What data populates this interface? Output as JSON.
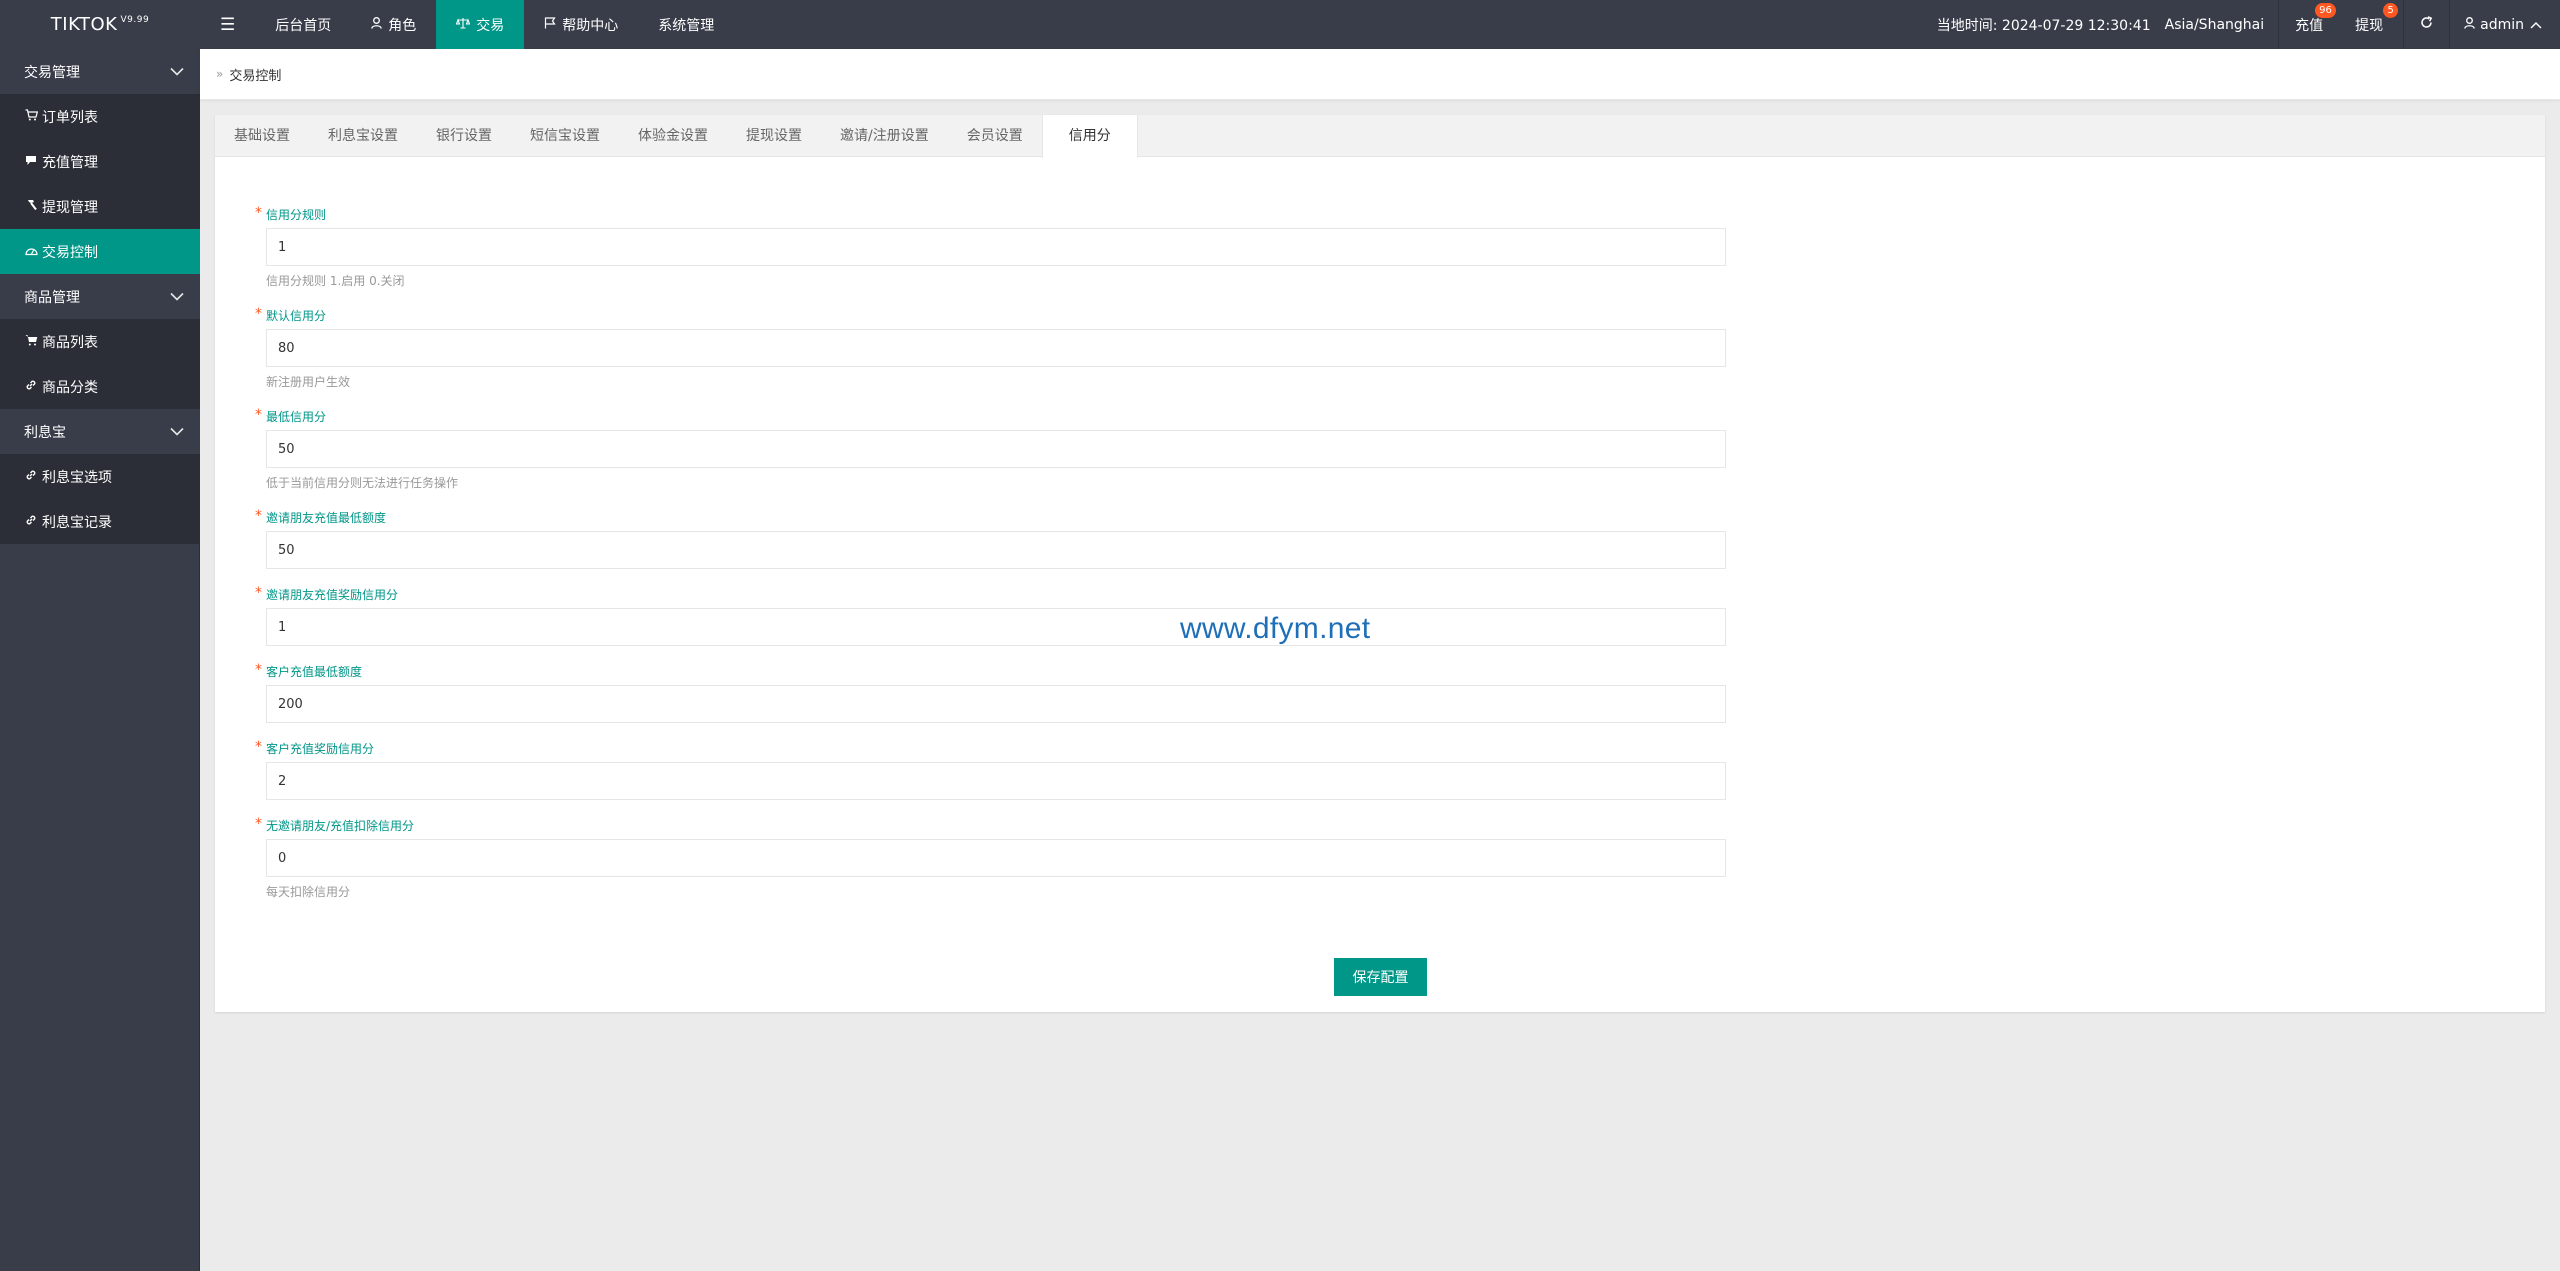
{
  "brand": {
    "name": "TIKTOK",
    "version": "V9.99"
  },
  "topnav": {
    "menu_icon": "menu-icon",
    "items": [
      {
        "label": "后台首页",
        "icon": ""
      },
      {
        "label": "角色",
        "icon": "user-icon"
      },
      {
        "label": "交易",
        "icon": "scale-icon",
        "active": true
      },
      {
        "label": "帮助中心",
        "icon": "flag-icon"
      },
      {
        "label": "系统管理",
        "icon": ""
      }
    ]
  },
  "topright": {
    "time_label": "当地时间: 2024-07-29 12:30:41",
    "timezone": "Asia/Shanghai",
    "recharge": {
      "label": "充值",
      "badge": "96"
    },
    "withdraw": {
      "label": "提现",
      "badge": "5"
    },
    "refresh_icon": "refresh-icon",
    "user": {
      "label": "admin",
      "icon": "user-icon",
      "chevron": "chevron-up-icon"
    }
  },
  "sidebar": {
    "groups": [
      {
        "label": "交易管理",
        "items": [
          {
            "label": "订单列表",
            "icon": "cart-icon"
          },
          {
            "label": "充值管理",
            "icon": "comment-icon"
          },
          {
            "label": "提现管理",
            "icon": "hammer-icon"
          },
          {
            "label": "交易控制",
            "icon": "dashboard-icon",
            "active": true
          }
        ]
      },
      {
        "label": "商品管理",
        "items": [
          {
            "label": "商品列表",
            "icon": "cart-icon"
          },
          {
            "label": "商品分类",
            "icon": "link-icon"
          }
        ]
      },
      {
        "label": "利息宝",
        "items": [
          {
            "label": "利息宝选项",
            "icon": "link-icon"
          },
          {
            "label": "利息宝记录",
            "icon": "link-icon"
          }
        ]
      }
    ]
  },
  "breadcrumb": {
    "current": "交易控制"
  },
  "tabs": [
    {
      "label": "基础设置"
    },
    {
      "label": "利息宝设置"
    },
    {
      "label": "银行设置"
    },
    {
      "label": "短信宝设置"
    },
    {
      "label": "体验金设置"
    },
    {
      "label": "提现设置"
    },
    {
      "label": "邀请/注册设置"
    },
    {
      "label": "会员设置"
    },
    {
      "label": "信用分",
      "active": true
    }
  ],
  "form": {
    "fields": [
      {
        "label": "信用分规则",
        "value": "1",
        "tip": "信用分规则 1.启用 0.关闭"
      },
      {
        "label": "默认信用分",
        "value": "80",
        "tip": "新注册用户生效"
      },
      {
        "label": "最低信用分",
        "value": "50",
        "tip": "低于当前信用分则无法进行任务操作"
      },
      {
        "label": "邀请朋友充值最低额度",
        "value": "50",
        "tip": ""
      },
      {
        "label": "邀请朋友充值奖励信用分",
        "value": "1",
        "tip": ""
      },
      {
        "label": "客户充值最低额度",
        "value": "200",
        "tip": ""
      },
      {
        "label": "客户充值奖励信用分",
        "value": "2",
        "tip": ""
      },
      {
        "label": "无邀请朋友/充值扣除信用分",
        "value": "0",
        "tip": "每天扣除信用分"
      }
    ],
    "required_mark": "*",
    "save_label": "保存配置"
  },
  "watermark": "www.dfym.net",
  "colors": {
    "accent": "#009688",
    "header_bg": "#393d49",
    "badge": "#ff5722",
    "watermark": "#1e6fb8"
  }
}
